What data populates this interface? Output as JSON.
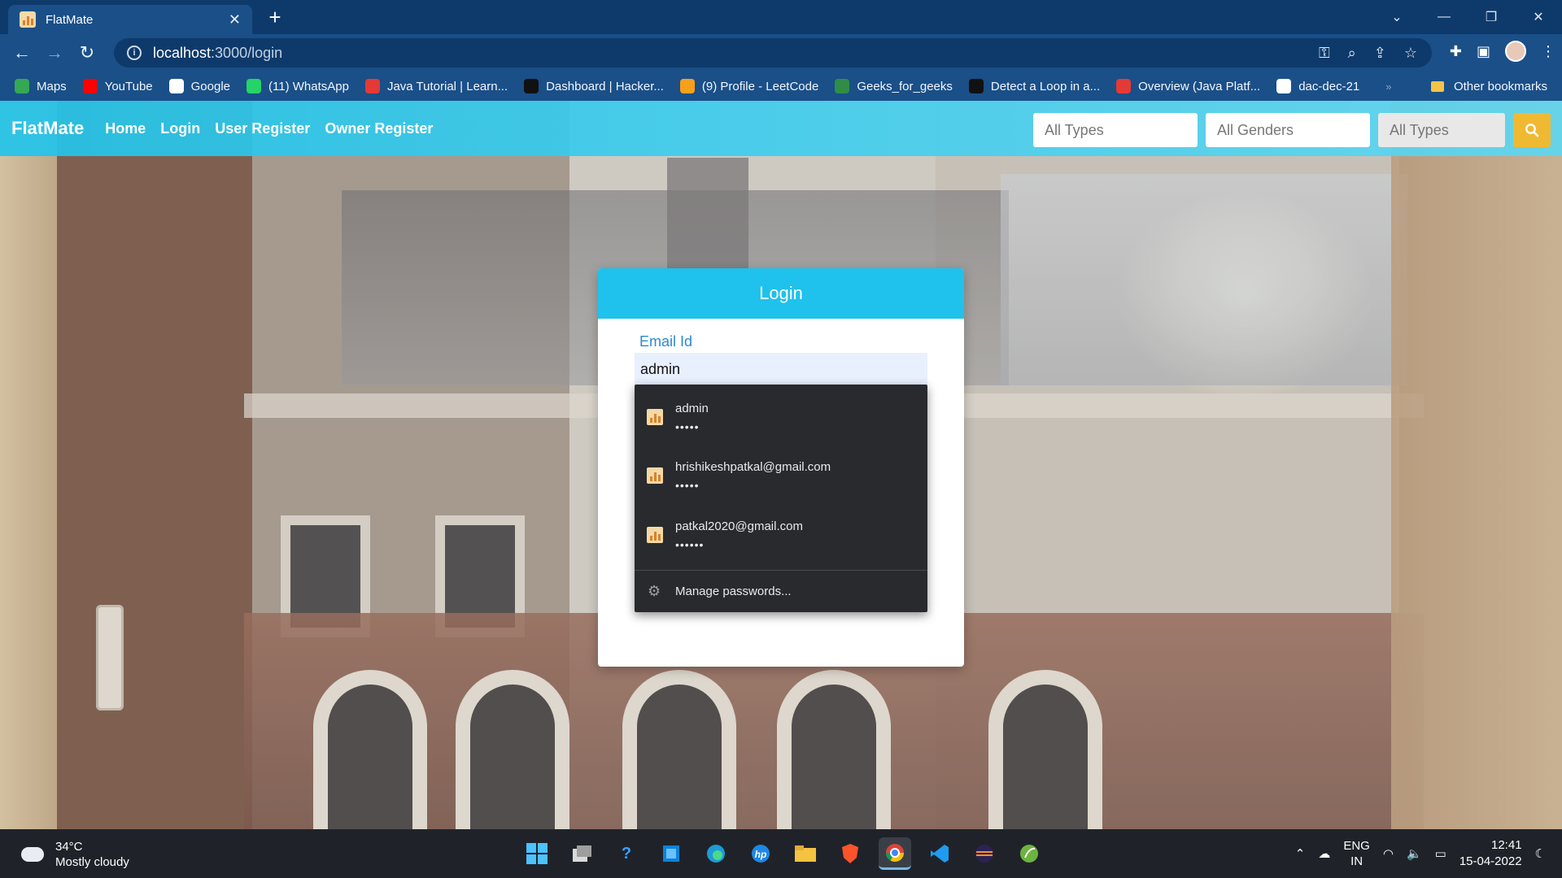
{
  "browser": {
    "tab_title": "FlatMate",
    "tab_close": "✕",
    "new_tab": "+",
    "url_host": "localhost",
    "url_path": ":3000/login",
    "window_controls": [
      "⌄",
      "—",
      "❐",
      "✕"
    ],
    "bookmarks": [
      {
        "label": "Maps",
        "icon": "maps-icon",
        "color": "#34a853"
      },
      {
        "label": "YouTube",
        "icon": "youtube-icon",
        "color": "#ff0000"
      },
      {
        "label": "Google",
        "icon": "google-icon",
        "color": "#ffffff"
      },
      {
        "label": "(11) WhatsApp",
        "icon": "whatsapp-icon",
        "color": "#25d366"
      },
      {
        "label": "Java Tutorial | Learn...",
        "icon": "java-tutorial-icon",
        "color": "#e53935"
      },
      {
        "label": "Dashboard | Hacker...",
        "icon": "hackerrank-icon",
        "color": "#111111"
      },
      {
        "label": "(9) Profile - LeetCode",
        "icon": "leetcode-icon",
        "color": "#f89f1b"
      },
      {
        "label": "Geeks_for_geeks",
        "icon": "gfg-icon",
        "color": "#2f8d46"
      },
      {
        "label": "Detect a Loop in a...",
        "icon": "play-icon",
        "color": "#111111"
      },
      {
        "label": "Overview (Java Platf...",
        "icon": "oracle-icon",
        "color": "#e53935"
      },
      {
        "label": "dac-dec-21",
        "icon": "github-icon",
        "color": "#ffffff"
      }
    ],
    "bookmarks_more": "»",
    "other_bookmarks": "Other bookmarks"
  },
  "app": {
    "brand": "FlatMate",
    "nav": [
      "Home",
      "Login",
      "User Register",
      "Owner Register"
    ],
    "filters": [
      "All Types",
      "All Genders",
      "All Types"
    ],
    "accent": "#1ec2ec",
    "search_color": "#efb932"
  },
  "login": {
    "title": "Login",
    "email_label": "Email Id",
    "email_value": "admin"
  },
  "autofill": {
    "items": [
      {
        "user": "admin",
        "mask": "•••••"
      },
      {
        "user": "hrishikeshpatkal@gmail.com",
        "mask": "•••••"
      },
      {
        "user": "patkal2020@gmail.com",
        "mask": "••••••"
      }
    ],
    "manage": "Manage passwords..."
  },
  "taskbar": {
    "temp": "34°C",
    "condition": "Mostly cloudy",
    "lang1": "ENG",
    "lang2": "IN",
    "time": "12:41",
    "date": "15-04-2022"
  }
}
